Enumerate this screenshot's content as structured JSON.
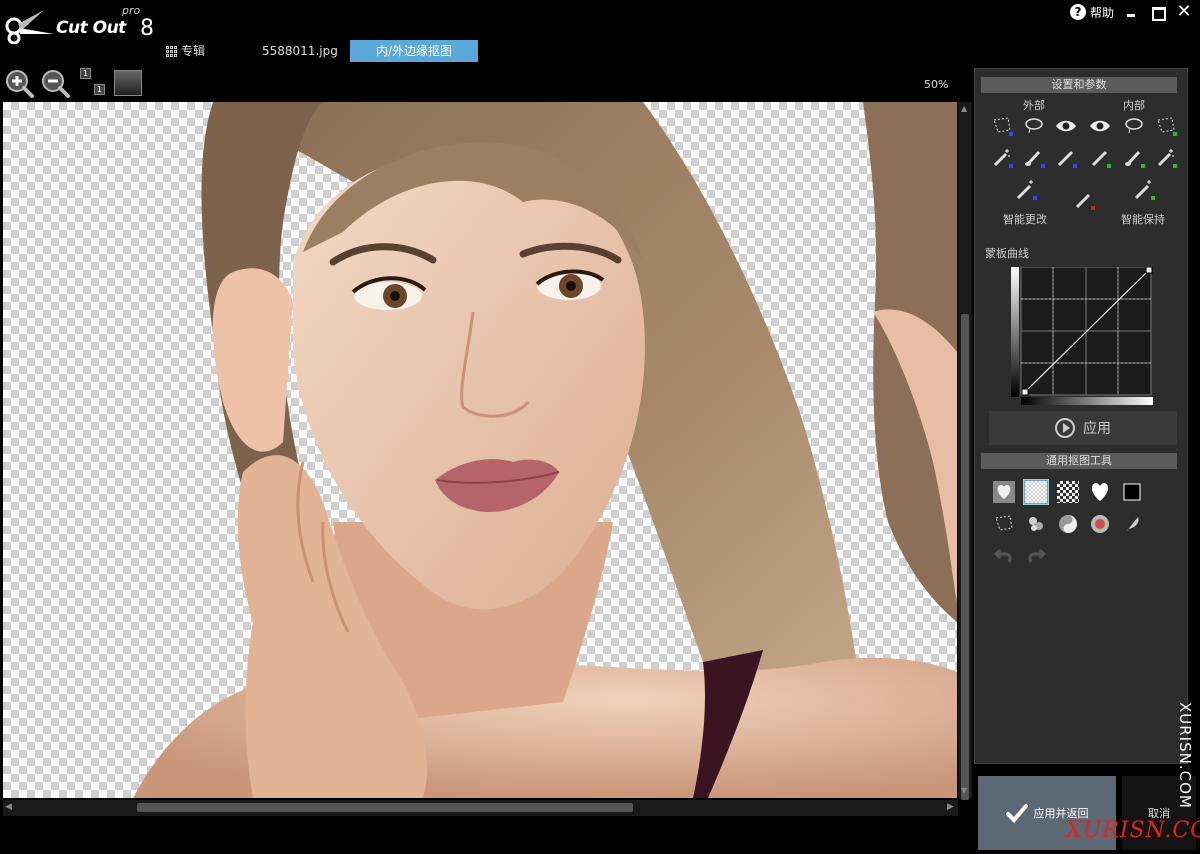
{
  "app": {
    "logo_text": "Cut Out",
    "logo_edition": "pro",
    "logo_version": "8"
  },
  "window": {
    "help_label": "帮助",
    "close_glyph": "✕"
  },
  "tabs": [
    {
      "label": "专辑"
    },
    {
      "label": "5588011.jpg"
    },
    {
      "label": "内/外边缘抠图"
    }
  ],
  "toolbar": {
    "zoom_level": "50%",
    "one_to_one_top": "1",
    "one_to_one_bottom": "1"
  },
  "panel": {
    "settings_header": "设置和参数",
    "outside_label": "外部",
    "inside_label": "内部",
    "smart_change_label": "智能更改",
    "smart_keep_label": "智能保持",
    "curve_label": "蒙板曲线",
    "apply_label": "应用",
    "tools_header": "通用抠图工具"
  },
  "footer": {
    "ok_label": "应用并返回",
    "cancel_label": "取消"
  },
  "watermark": {
    "vertical": "XURISN.COM",
    "horizontal": "XURISN.COM"
  },
  "colors": {
    "accent_tab": "#5aa7d9",
    "tool_blue": "#2a4cff",
    "tool_green": "#1ec31e",
    "tool_red": "#e02020",
    "watermark_red": "#e82020"
  }
}
